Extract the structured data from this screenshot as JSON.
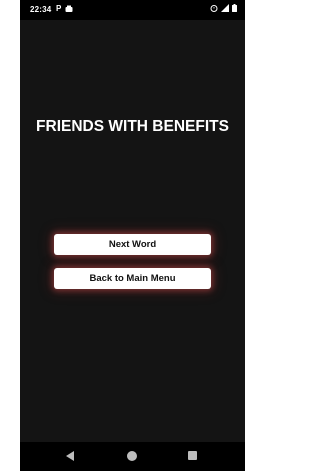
{
  "status_bar": {
    "time": "22:34",
    "left_icons": [
      "parking-p-icon",
      "notification-icon"
    ],
    "right_icons": [
      "alarm-icon",
      "signal-icon",
      "battery-icon"
    ]
  },
  "main": {
    "title": "FRIENDS WITH BENEFITS",
    "next_word_label": "Next Word",
    "back_to_menu_label": "Back to Main Menu"
  },
  "nav_bar": {
    "icons": [
      "back-icon",
      "home-icon",
      "recents-icon"
    ]
  },
  "colors": {
    "background": "#141414",
    "button_background": "#ffffff",
    "button_glow": "#b44646",
    "title_text": "#ffffff"
  }
}
